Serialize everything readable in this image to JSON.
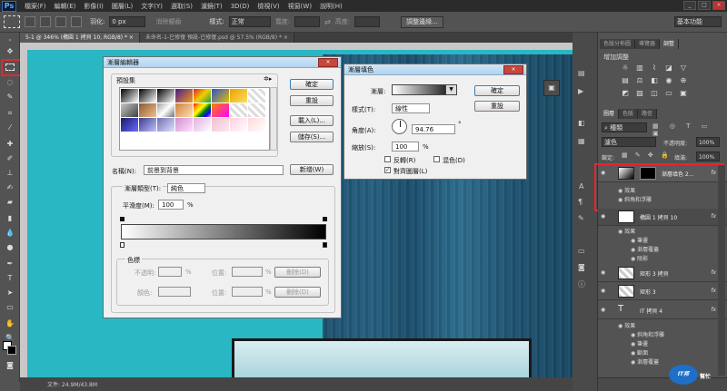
{
  "menubar": {
    "logo": "Ps",
    "items": [
      "檔案(F)",
      "編輯(E)",
      "影像(I)",
      "圖層(L)",
      "文字(Y)",
      "選取(S)",
      "濾鏡(T)",
      "3D(D)",
      "檢視(V)",
      "視窗(W)",
      "說明(H)"
    ],
    "workspace": "基本功能"
  },
  "options": {
    "feather_label": "羽化:",
    "feather_value": "0 px",
    "antialias_label": "消除鋸齒",
    "style_label": "樣式:",
    "style_value": "正常",
    "width_label": "寬度:",
    "height_label": "高度:",
    "refine_button": "調整邊緣..."
  },
  "tabs": {
    "doc1": "5-1 @ 346% (橢圓 1 拷貝 10, RGB/8) * ×",
    "doc2": "未命名-1-已修復 預設-已修復.psd @ 57.5% (RGB/8) * ×"
  },
  "status": {
    "doc_info": "文件: 24.9M/43.8M"
  },
  "gradient_editor": {
    "title": "漸層編輯器",
    "presets_label": "預設集",
    "ok": "確定",
    "reset": "重設",
    "load": "載入(L)...",
    "save": "儲存(S)...",
    "name_label": "名稱(N):",
    "name_value": "前景到背景",
    "new_button": "新增(W)",
    "type_label": "漸層類型(T):",
    "type_value": "純色",
    "smooth_label": "平滑度(M):",
    "smooth_value": "100",
    "smooth_unit": "%",
    "stops_label": "色標",
    "opacity_label": "不透明:",
    "location_label": "位置:",
    "delete_label": "刪除(D)",
    "color_label": "顏色:",
    "percent": "%"
  },
  "gradient_overlay": {
    "title": "漸層填色",
    "gradient_label": "漸層:",
    "ok": "確定",
    "reset": "重設",
    "style_label": "樣式(T):",
    "style_value": "線性",
    "angle_label": "角度(A):",
    "angle_value": "94.76",
    "angle_unit": "°",
    "scale_label": "縮放(S):",
    "scale_value": "100",
    "scale_unit": "%",
    "reverse_label": "反轉(R)",
    "dither_label": "混色(D)",
    "align_label": "對齊圖層(L)"
  },
  "right_panel": {
    "tabs1": [
      "色版分佈圖",
      "導覽器",
      "調整"
    ],
    "adjust_title": "增加調整",
    "tabs2": [
      "圖層",
      "色版",
      "路徑"
    ],
    "kind_label": "種類",
    "blend_mode": "濾色",
    "opacity_label": "不透明度:",
    "opacity_value": "100%",
    "lock_label": "鎖定:",
    "fill_label": "填滿:",
    "fill_value": "100%",
    "layers": [
      {
        "name": "漸層填色 2...",
        "fx": "fx"
      },
      {
        "name": "橢圓 1 拷貝 10",
        "fx": "fx"
      },
      {
        "name": "矩形 3 拷貝",
        "fx": "fx"
      },
      {
        "name": "矩形 3",
        "fx": "fx"
      },
      {
        "name": "IT 拷貝 4",
        "fx": "fx"
      }
    ],
    "effects_label": "效果",
    "effect_bevel": "斜角和浮雕",
    "effect_stroke": "筆畫",
    "effect_overlay": "漸層覆蓋",
    "effect_shadow": "陰影",
    "effect_inner_shadow": "斷面",
    "watermark_top": "IT邦",
    "watermark_bottom": "幫忙"
  }
}
